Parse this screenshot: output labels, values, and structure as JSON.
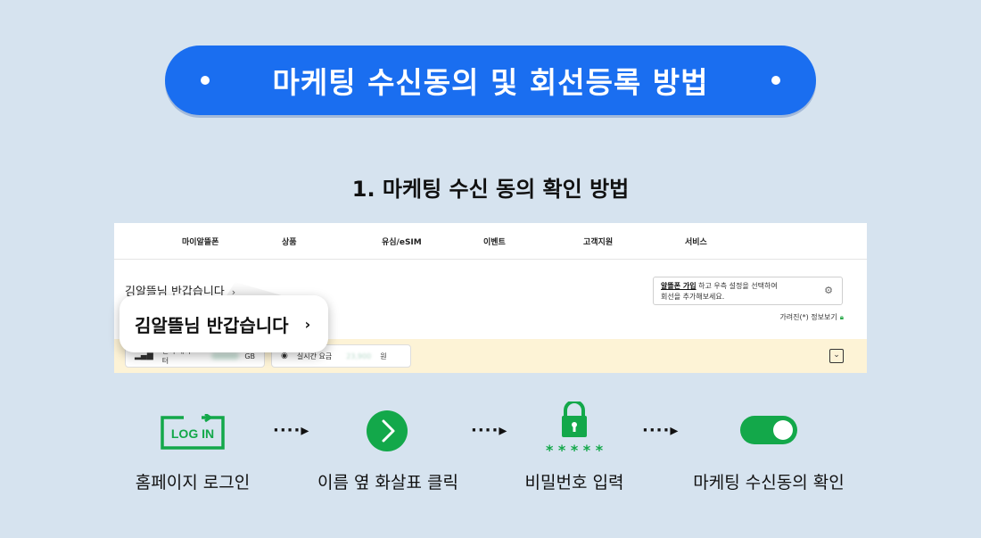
{
  "header": {
    "title": "마케팅 수신동의 및 회선등록 방법"
  },
  "section": {
    "heading": "1. 마케팅 수신 동의 확인 방법"
  },
  "mockup": {
    "nav_items": [
      "마이알뜰폰",
      "상품",
      "유심/eSIM",
      "이벤트",
      "고객지원",
      "서비스"
    ],
    "greeting": "김알뜰님 반갑습니다",
    "greeting_chevron": "›",
    "info_link": "알뜰폰 가입",
    "info_text_1": " 하고 우측 설정을 선택하여",
    "info_text_2": "회선을 추가해보세요.",
    "privacy_label": "가려진(*) 정보보기",
    "stat_data_label": "잔여 데이터",
    "stat_data_unit": "GB",
    "stat_fee_label": "실시간 요금",
    "stat_fee_value": "23,900",
    "stat_fee_unit": "원",
    "dropdown_glyph": "⌄"
  },
  "bubble": {
    "greeting": "김알뜰님 반갑습니다",
    "chevron": "›"
  },
  "steps": [
    {
      "icon": "login-icon",
      "icon_text": "LOG IN",
      "label": "홈페이지 로그인"
    },
    {
      "icon": "arrow-circle-icon",
      "label": "이름 옆 화살표 클릭"
    },
    {
      "icon": "lock-icon",
      "icon_text": "* * * * *",
      "label": "비밀번호 입력"
    },
    {
      "icon": "toggle-on-icon",
      "label": "마케팅 수신동의 확인"
    }
  ],
  "connector": "····▸",
  "colors": {
    "background": "#d6e3ef",
    "pill": "#1a6ef0",
    "green": "#13a84a",
    "yellow_band": "#fdf3d6"
  }
}
